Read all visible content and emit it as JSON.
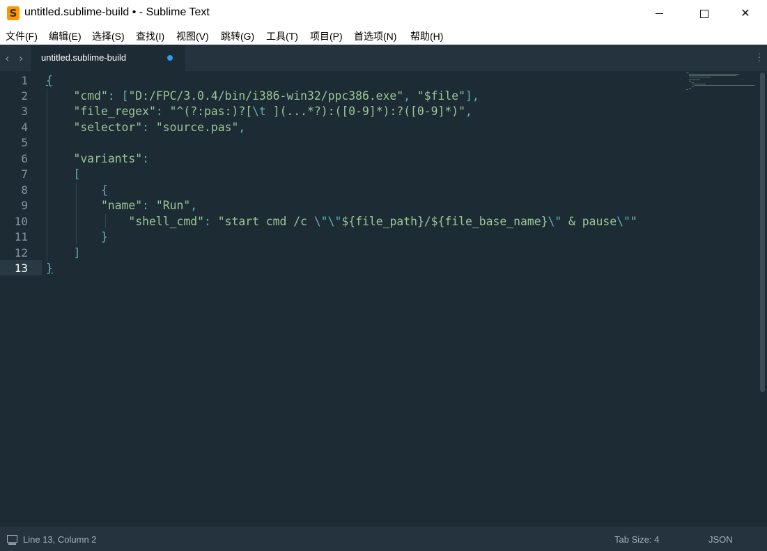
{
  "window": {
    "title": "untitled.sublime-build • - Sublime Text",
    "app_icon_letter": "S"
  },
  "menu": [
    "文件(F)",
    "编辑(E)",
    "选择(S)",
    "查找(I)",
    "视图(V)",
    "跳转(G)",
    "工具(T)",
    "项目(P)",
    "首选项(N)",
    "帮助(H)"
  ],
  "tabs": [
    {
      "label": "untitled.sublime-build",
      "dirty": true
    }
  ],
  "editor": {
    "line_numbers": [
      "1",
      "2",
      "3",
      "4",
      "5",
      "6",
      "7",
      "8",
      "9",
      "10",
      "11",
      "12",
      "13"
    ],
    "active_line": 13
  },
  "code": {
    "l2_key": "\"cmd\"",
    "l2_path": "\"D:/FPC/3.0.4/bin/i386-win32/ppc386.exe\"",
    "l2_file": "\"$file\"",
    "l3_key": "\"file_regex\"",
    "l3_val_a": "\"^(?:pas:)?[",
    "l3_val_esc": "\\t",
    "l3_val_b": " ](...*?):([0-9]*):?([0-9]*)\"",
    "l4_key": "\"selector\"",
    "l4_val": "\"source.pas\"",
    "l6_key": "\"variants\"",
    "l9_key": "\"name\"",
    "l9_val": "\"Run\"",
    "l10_key": "\"shell_cmd\"",
    "l10_val_a": "\"start cmd /c ",
    "l10_esc1": "\\\"",
    "l10_esc2": "\\\"",
    "l10_val_b": "${file_path}/${file_base_name}",
    "l10_esc3": "\\\"",
    "l10_val_c": " & pause",
    "l10_esc4": "\\\"",
    "l10_val_d": "\""
  },
  "status": {
    "position": "Line 13, Column 2",
    "tab_size": "Tab Size: 4",
    "syntax": "JSON"
  },
  "colors": {
    "background": "#1d2b35",
    "string": "#99c794",
    "punctuation": "#5fb3b3",
    "tab_dirty": "#2f9cee"
  }
}
